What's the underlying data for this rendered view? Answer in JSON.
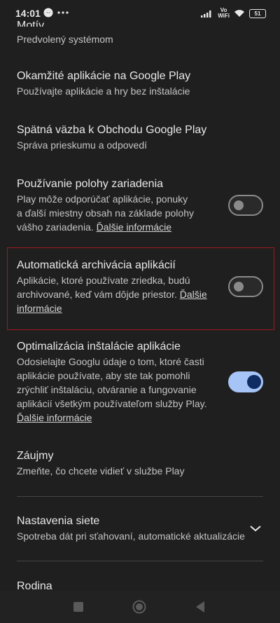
{
  "status": {
    "time": "14:01",
    "vowifi_top": "Vo",
    "vowifi_bottom": "WiFi",
    "battery": "51"
  },
  "motiv": {
    "title": "Motív",
    "subtitle": "Predvolený systémom"
  },
  "instant": {
    "title": "Okamžité aplikácie na Google Play",
    "subtitle": "Používajte aplikácie a hry bez inštalácie"
  },
  "feedback": {
    "title": "Spätná väzba k Obchodu Google Play",
    "subtitle": "Správa prieskumu a odpovedí"
  },
  "location": {
    "title": "Používanie polohy zariadenia",
    "lines": [
      "Play môže odporúčať aplikácie, ponuky",
      "a ďalší miestny obsah na základe polohy",
      "vášho zariadenia."
    ],
    "link": "Ďalšie informácie",
    "enabled": false
  },
  "archive": {
    "title": "Automatická archivácia aplikácií",
    "lines": [
      "Aplikácie, ktoré používate zriedka, budú",
      "archivované, keď vám dôjde priestor."
    ],
    "link_part1": "Ďalšie",
    "link_part2": "informácie",
    "enabled": false
  },
  "optimize": {
    "title": "Optimalizácia inštalácie aplikácie",
    "lines": [
      "Odosielajte Googlu údaje o tom, ktoré časti",
      "aplikácie používate, aby ste tak pomohli",
      "zrýchliť inštaláciu, otváranie a fungovanie",
      "aplikácií všetkým používateľom služby Play."
    ],
    "link": "Ďalšie informácie",
    "enabled": true
  },
  "interests": {
    "title": "Záujmy",
    "subtitle": "Zmeňte, čo chcete vidieť v službe Play"
  },
  "network": {
    "title": "Nastavenia siete",
    "subtitle": "Spotreba dát pri sťahovaní, automatické aktualizácie"
  },
  "family": {
    "title": "Rodina"
  }
}
